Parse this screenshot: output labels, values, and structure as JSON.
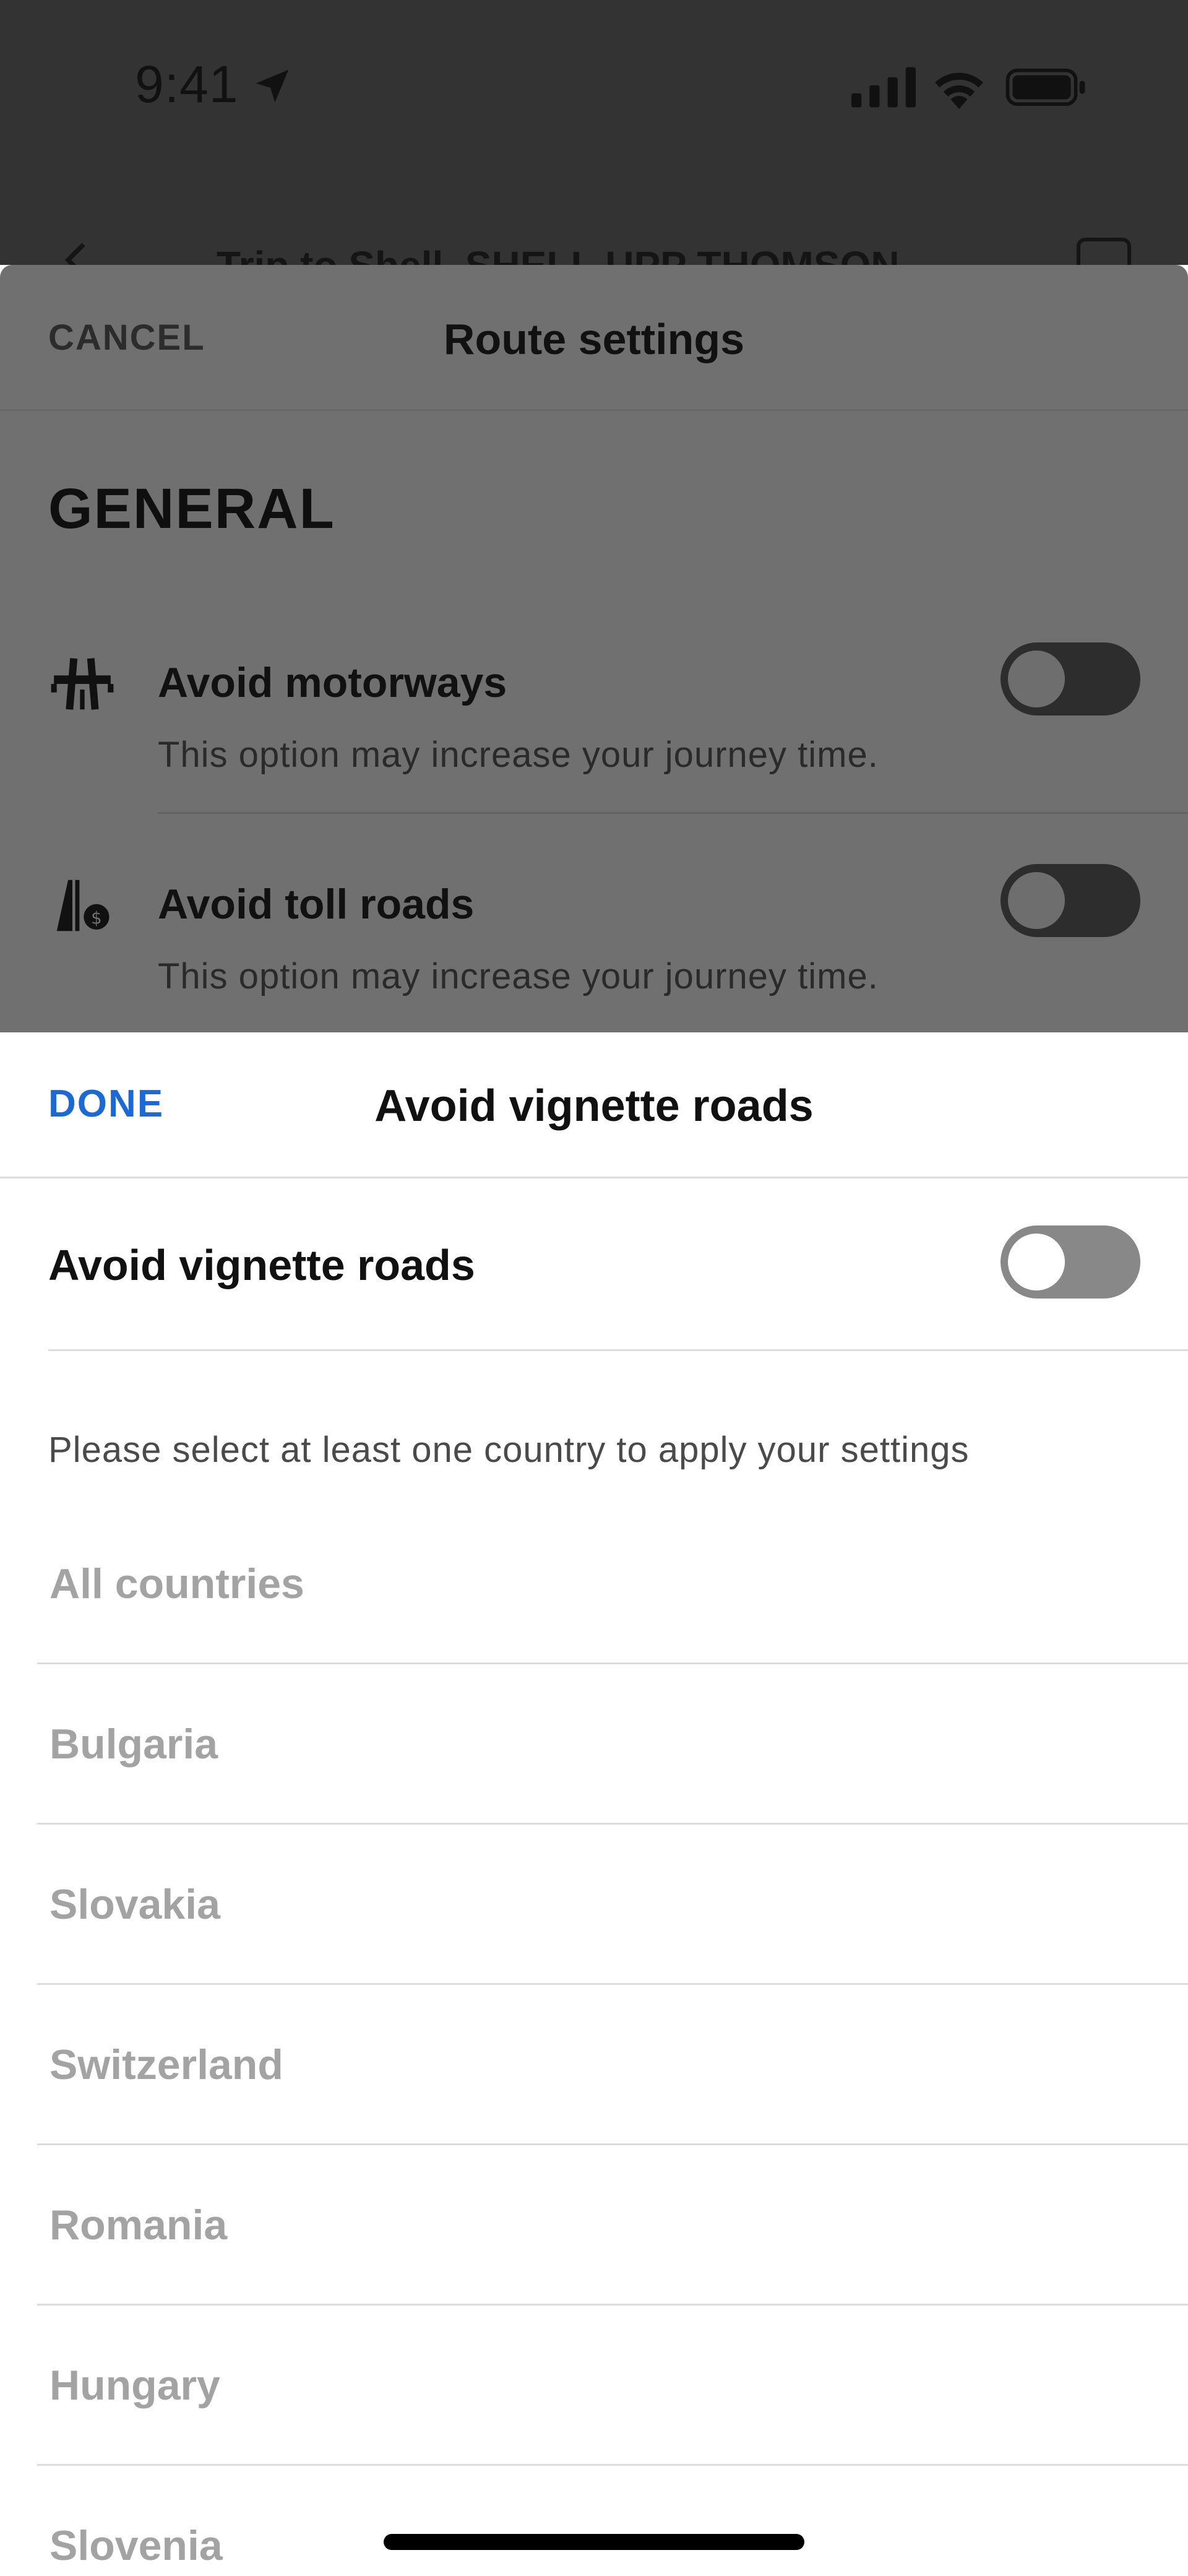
{
  "status_bar": {
    "time": "9:41"
  },
  "trip_header": {
    "title": "Trip to Shell, SHELL UPP THOMSON"
  },
  "route_settings": {
    "cancel_label": "CANCEL",
    "title": "Route settings",
    "section_title": "GENERAL",
    "options": [
      {
        "icon": "motorway-icon",
        "title": "Avoid motorways",
        "description": "This option may increase your journey time.",
        "enabled": false
      },
      {
        "icon": "toll-road-icon",
        "title": "Avoid toll roads",
        "description": "This option may increase your journey time.",
        "enabled": false
      }
    ]
  },
  "modal": {
    "done_label": "DONE",
    "title": "Avoid vignette roads",
    "toggle_label": "Avoid vignette roads",
    "toggle_enabled": false,
    "hint": "Please select at least one country to apply your settings",
    "countries": [
      "All countries",
      "Bulgaria",
      "Slovakia",
      "Switzerland",
      "Romania",
      "Hungary",
      "Slovenia"
    ]
  },
  "colors": {
    "accent": "#1c69d4",
    "disabled_text": "#a3a3a3",
    "overlay": "#707070"
  }
}
